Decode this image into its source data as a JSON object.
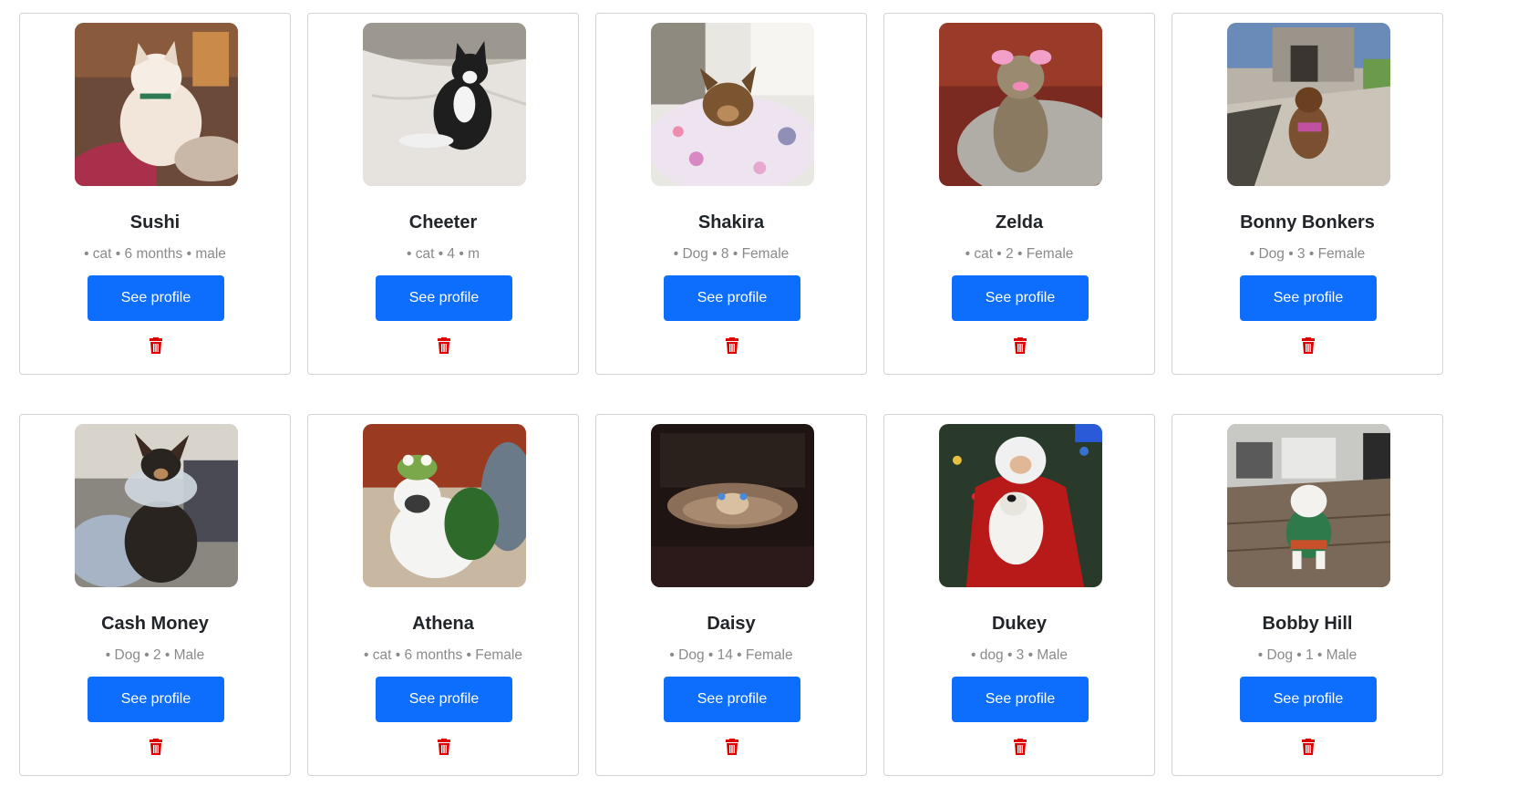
{
  "accent_color": "#0d6efd",
  "delete_color": "#e00000",
  "icons": {
    "delete": "trash-icon"
  },
  "pets": [
    {
      "name": "Sushi",
      "details": "• cat • 6 months • male",
      "button_label": "See profile"
    },
    {
      "name": "Cheeter",
      "details": "• cat • 4 • m",
      "button_label": "See profile"
    },
    {
      "name": "Shakira",
      "details": "• Dog • 8 • Female",
      "button_label": "See profile"
    },
    {
      "name": "Zelda",
      "details": "• cat • 2 • Female",
      "button_label": "See profile"
    },
    {
      "name": "Bonny Bonkers",
      "details": "• Dog • 3 • Female",
      "button_label": "See profile"
    },
    {
      "name": "Cash Money",
      "details": "• Dog • 2 • Male",
      "button_label": "See profile"
    },
    {
      "name": "Athena",
      "details": "• cat • 6 months • Female",
      "button_label": "See profile"
    },
    {
      "name": "Daisy",
      "details": "• Dog • 14 • Female",
      "button_label": "See profile"
    },
    {
      "name": "Dukey",
      "details": "• dog • 3 • Male",
      "button_label": "See profile"
    },
    {
      "name": "Bobby Hill",
      "details": "• Dog • 1 • Male",
      "button_label": "See profile"
    }
  ]
}
